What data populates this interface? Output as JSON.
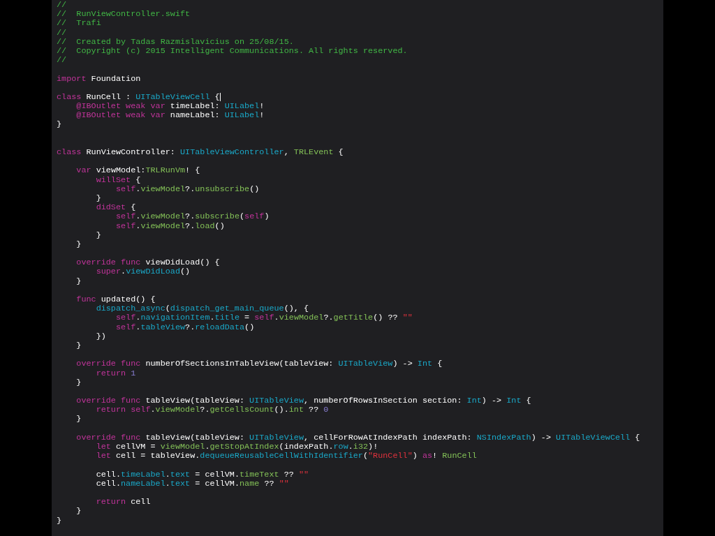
{
  "editor": {
    "lines": [
      {
        "cursor": false,
        "tokens": [
          {
            "text": "//",
            "kind": "comment"
          }
        ]
      },
      {
        "cursor": false,
        "tokens": [
          {
            "text": "//  RunViewController.swift",
            "kind": "comment"
          }
        ]
      },
      {
        "cursor": false,
        "tokens": [
          {
            "text": "//  Trafi",
            "kind": "comment"
          }
        ]
      },
      {
        "cursor": false,
        "tokens": [
          {
            "text": "//",
            "kind": "comment"
          }
        ]
      },
      {
        "cursor": false,
        "tokens": [
          {
            "text": "//  Created by Tadas Razmislavicius on 25/08/15.",
            "kind": "comment"
          }
        ]
      },
      {
        "cursor": false,
        "tokens": [
          {
            "text": "//  Copyright (c) 2015 Intelligent Communications. All rights reserved.",
            "kind": "comment"
          }
        ]
      },
      {
        "cursor": false,
        "tokens": [
          {
            "text": "//",
            "kind": "comment"
          }
        ]
      },
      {
        "cursor": false
      },
      {
        "cursor": false,
        "tokens": [
          {
            "text": "import",
            "kind": "keyword"
          },
          {
            "text": " Foundation",
            "kind": "plain"
          }
        ]
      },
      {
        "cursor": false
      },
      {
        "cursor": true,
        "tokens": [
          {
            "text": "class",
            "kind": "keyword"
          },
          {
            "text": " RunCell : ",
            "kind": "plain"
          },
          {
            "text": "UITableViewCell",
            "kind": "type"
          },
          {
            "text": " {",
            "kind": "plain"
          }
        ]
      },
      {
        "cursor": false,
        "tokens": [
          {
            "text": "    @IBOutlet weak var",
            "kind": "keyword"
          },
          {
            "text": " timeLabel: ",
            "kind": "plain"
          },
          {
            "text": "UILabel",
            "kind": "type"
          },
          {
            "text": "!",
            "kind": "plain"
          }
        ]
      },
      {
        "cursor": false,
        "tokens": [
          {
            "text": "    @IBOutlet weak var",
            "kind": "keyword"
          },
          {
            "text": " nameLabel: ",
            "kind": "plain"
          },
          {
            "text": "UILabel",
            "kind": "type"
          },
          {
            "text": "!",
            "kind": "plain"
          }
        ]
      },
      {
        "cursor": false,
        "tokens": [
          {
            "text": "}",
            "kind": "plain"
          }
        ]
      },
      {
        "cursor": false
      },
      {
        "cursor": false
      },
      {
        "cursor": false,
        "tokens": [
          {
            "text": "class",
            "kind": "keyword"
          },
          {
            "text": " RunViewController: ",
            "kind": "plain"
          },
          {
            "text": "UITableViewController",
            "kind": "type"
          },
          {
            "text": ", ",
            "kind": "plain"
          },
          {
            "text": "TRLEvent",
            "kind": "project"
          },
          {
            "text": " {",
            "kind": "plain"
          }
        ]
      },
      {
        "cursor": false
      },
      {
        "cursor": false,
        "tokens": [
          {
            "text": "    var",
            "kind": "keyword"
          },
          {
            "text": " viewModel:",
            "kind": "plain"
          },
          {
            "text": "TRLRunVm",
            "kind": "project"
          },
          {
            "text": "! {",
            "kind": "plain"
          }
        ]
      },
      {
        "cursor": false,
        "tokens": [
          {
            "text": "        willSet",
            "kind": "keyword"
          },
          {
            "text": " {",
            "kind": "plain"
          }
        ]
      },
      {
        "cursor": false,
        "tokens": [
          {
            "text": "            self",
            "kind": "keyword"
          },
          {
            "text": ".",
            "kind": "plain"
          },
          {
            "text": "viewModel",
            "kind": "project"
          },
          {
            "text": "?.",
            "kind": "plain"
          },
          {
            "text": "unsubscribe",
            "kind": "project"
          },
          {
            "text": "()",
            "kind": "plain"
          }
        ]
      },
      {
        "cursor": false,
        "tokens": [
          {
            "text": "        }",
            "kind": "plain"
          }
        ]
      },
      {
        "cursor": false,
        "tokens": [
          {
            "text": "        didSet",
            "kind": "keyword"
          },
          {
            "text": " {",
            "kind": "plain"
          }
        ]
      },
      {
        "cursor": false,
        "tokens": [
          {
            "text": "            self",
            "kind": "keyword"
          },
          {
            "text": ".",
            "kind": "plain"
          },
          {
            "text": "viewModel",
            "kind": "project"
          },
          {
            "text": "?.",
            "kind": "plain"
          },
          {
            "text": "subscribe",
            "kind": "project"
          },
          {
            "text": "(",
            "kind": "plain"
          },
          {
            "text": "self",
            "kind": "keyword"
          },
          {
            "text": ")",
            "kind": "plain"
          }
        ]
      },
      {
        "cursor": false,
        "tokens": [
          {
            "text": "            self",
            "kind": "keyword"
          },
          {
            "text": ".",
            "kind": "plain"
          },
          {
            "text": "viewModel",
            "kind": "project"
          },
          {
            "text": "?.",
            "kind": "plain"
          },
          {
            "text": "load",
            "kind": "project"
          },
          {
            "text": "()",
            "kind": "plain"
          }
        ]
      },
      {
        "cursor": false,
        "tokens": [
          {
            "text": "        }",
            "kind": "plain"
          }
        ]
      },
      {
        "cursor": false,
        "tokens": [
          {
            "text": "    }",
            "kind": "plain"
          }
        ]
      },
      {
        "cursor": false
      },
      {
        "cursor": false,
        "tokens": [
          {
            "text": "    override func",
            "kind": "keyword"
          },
          {
            "text": " viewDidLoad() {",
            "kind": "plain"
          }
        ]
      },
      {
        "cursor": false,
        "tokens": [
          {
            "text": "        super",
            "kind": "keyword"
          },
          {
            "text": ".",
            "kind": "plain"
          },
          {
            "text": "viewDidLoad",
            "kind": "type"
          },
          {
            "text": "()",
            "kind": "plain"
          }
        ]
      },
      {
        "cursor": false,
        "tokens": [
          {
            "text": "    }",
            "kind": "plain"
          }
        ]
      },
      {
        "cursor": false
      },
      {
        "cursor": false,
        "tokens": [
          {
            "text": "    func",
            "kind": "keyword"
          },
          {
            "text": " updated() {",
            "kind": "plain"
          }
        ]
      },
      {
        "cursor": false,
        "tokens": [
          {
            "text": "        dispatch_async",
            "kind": "type"
          },
          {
            "text": "(",
            "kind": "plain"
          },
          {
            "text": "dispatch_get_main_queue",
            "kind": "type"
          },
          {
            "text": "(), {",
            "kind": "plain"
          }
        ]
      },
      {
        "cursor": false,
        "tokens": [
          {
            "text": "            self",
            "kind": "keyword"
          },
          {
            "text": ".",
            "kind": "plain"
          },
          {
            "text": "navigationItem",
            "kind": "type"
          },
          {
            "text": ".",
            "kind": "plain"
          },
          {
            "text": "title",
            "kind": "type"
          },
          {
            "text": " = ",
            "kind": "plain"
          },
          {
            "text": "self",
            "kind": "keyword"
          },
          {
            "text": ".",
            "kind": "plain"
          },
          {
            "text": "viewModel",
            "kind": "project"
          },
          {
            "text": "?.",
            "kind": "plain"
          },
          {
            "text": "getTitle",
            "kind": "project"
          },
          {
            "text": "() ?? ",
            "kind": "plain"
          },
          {
            "text": "\"\"",
            "kind": "string"
          }
        ]
      },
      {
        "cursor": false,
        "tokens": [
          {
            "text": "            self",
            "kind": "keyword"
          },
          {
            "text": ".",
            "kind": "plain"
          },
          {
            "text": "tableView",
            "kind": "type"
          },
          {
            "text": "?.",
            "kind": "plain"
          },
          {
            "text": "reloadData",
            "kind": "type"
          },
          {
            "text": "()",
            "kind": "plain"
          }
        ]
      },
      {
        "cursor": false,
        "tokens": [
          {
            "text": "        })",
            "kind": "plain"
          }
        ]
      },
      {
        "cursor": false,
        "tokens": [
          {
            "text": "    }",
            "kind": "plain"
          }
        ]
      },
      {
        "cursor": false
      },
      {
        "cursor": false,
        "tokens": [
          {
            "text": "    override func",
            "kind": "keyword"
          },
          {
            "text": " numberOfSectionsInTableView(tableView: ",
            "kind": "plain"
          },
          {
            "text": "UITableView",
            "kind": "type"
          },
          {
            "text": ") -> ",
            "kind": "plain"
          },
          {
            "text": "Int",
            "kind": "type"
          },
          {
            "text": " {",
            "kind": "plain"
          }
        ]
      },
      {
        "cursor": false,
        "tokens": [
          {
            "text": "        return",
            "kind": "keyword"
          },
          {
            "text": " 1",
            "kind": "number"
          }
        ]
      },
      {
        "cursor": false,
        "tokens": [
          {
            "text": "    }",
            "kind": "plain"
          }
        ]
      },
      {
        "cursor": false
      },
      {
        "cursor": false,
        "tokens": [
          {
            "text": "    override func",
            "kind": "keyword"
          },
          {
            "text": " tableView(tableView: ",
            "kind": "plain"
          },
          {
            "text": "UITableView",
            "kind": "type"
          },
          {
            "text": ", numberOfRowsInSection section: ",
            "kind": "plain"
          },
          {
            "text": "Int",
            "kind": "type"
          },
          {
            "text": ") -> ",
            "kind": "plain"
          },
          {
            "text": "Int",
            "kind": "type"
          },
          {
            "text": " {",
            "kind": "plain"
          }
        ]
      },
      {
        "cursor": false,
        "tokens": [
          {
            "text": "        return self",
            "kind": "keyword"
          },
          {
            "text": ".",
            "kind": "plain"
          },
          {
            "text": "viewModel",
            "kind": "project"
          },
          {
            "text": "?.",
            "kind": "plain"
          },
          {
            "text": "getCellsCount",
            "kind": "project"
          },
          {
            "text": "().",
            "kind": "plain"
          },
          {
            "text": "int",
            "kind": "project"
          },
          {
            "text": " ?? ",
            "kind": "plain"
          },
          {
            "text": "0",
            "kind": "number"
          }
        ]
      },
      {
        "cursor": false,
        "tokens": [
          {
            "text": "    }",
            "kind": "plain"
          }
        ]
      },
      {
        "cursor": false
      },
      {
        "cursor": false,
        "tokens": [
          {
            "text": "    override func",
            "kind": "keyword"
          },
          {
            "text": " tableView(tableView: ",
            "kind": "plain"
          },
          {
            "text": "UITableView",
            "kind": "type"
          },
          {
            "text": ", cellForRowAtIndexPath indexPath: ",
            "kind": "plain"
          },
          {
            "text": "NSIndexPath",
            "kind": "type"
          },
          {
            "text": ") -> ",
            "kind": "plain"
          },
          {
            "text": "UITableViewCell",
            "kind": "type"
          },
          {
            "text": " {",
            "kind": "plain"
          }
        ]
      },
      {
        "cursor": false,
        "tokens": [
          {
            "text": "        let",
            "kind": "keyword"
          },
          {
            "text": " cellVM = ",
            "kind": "plain"
          },
          {
            "text": "viewModel",
            "kind": "project"
          },
          {
            "text": ".",
            "kind": "plain"
          },
          {
            "text": "getStopAtIndex",
            "kind": "project"
          },
          {
            "text": "(indexPath.",
            "kind": "plain"
          },
          {
            "text": "row",
            "kind": "type"
          },
          {
            "text": ".",
            "kind": "plain"
          },
          {
            "text": "i32",
            "kind": "project"
          },
          {
            "text": ")!",
            "kind": "plain"
          }
        ]
      },
      {
        "cursor": false,
        "tokens": [
          {
            "text": "        let",
            "kind": "keyword"
          },
          {
            "text": " cell = tableView.",
            "kind": "plain"
          },
          {
            "text": "dequeueReusableCellWithIdentifier",
            "kind": "type"
          },
          {
            "text": "(",
            "kind": "plain"
          },
          {
            "text": "\"RunCell\"",
            "kind": "string"
          },
          {
            "text": ") ",
            "kind": "plain"
          },
          {
            "text": "as",
            "kind": "keyword"
          },
          {
            "text": "! ",
            "kind": "plain"
          },
          {
            "text": "RunCell",
            "kind": "project"
          }
        ]
      },
      {
        "cursor": false
      },
      {
        "cursor": false,
        "tokens": [
          {
            "text": "        cell.",
            "kind": "plain"
          },
          {
            "text": "timeLabel",
            "kind": "type"
          },
          {
            "text": ".",
            "kind": "plain"
          },
          {
            "text": "text",
            "kind": "type"
          },
          {
            "text": " = cellVM.",
            "kind": "plain"
          },
          {
            "text": "timeText",
            "kind": "project"
          },
          {
            "text": " ?? ",
            "kind": "plain"
          },
          {
            "text": "\"\"",
            "kind": "string"
          }
        ]
      },
      {
        "cursor": false,
        "tokens": [
          {
            "text": "        cell.",
            "kind": "plain"
          },
          {
            "text": "nameLabel",
            "kind": "type"
          },
          {
            "text": ".",
            "kind": "plain"
          },
          {
            "text": "text",
            "kind": "type"
          },
          {
            "text": " = cellVM.",
            "kind": "plain"
          },
          {
            "text": "name",
            "kind": "project"
          },
          {
            "text": " ?? ",
            "kind": "plain"
          },
          {
            "text": "\"\"",
            "kind": "string"
          }
        ]
      },
      {
        "cursor": false
      },
      {
        "cursor": false,
        "tokens": [
          {
            "text": "        return",
            "kind": "keyword"
          },
          {
            "text": " cell",
            "kind": "plain"
          }
        ]
      },
      {
        "cursor": false,
        "tokens": [
          {
            "text": "    }",
            "kind": "plain"
          }
        ]
      },
      {
        "cursor": false,
        "tokens": [
          {
            "text": "}",
            "kind": "plain"
          }
        ]
      }
    ]
  }
}
